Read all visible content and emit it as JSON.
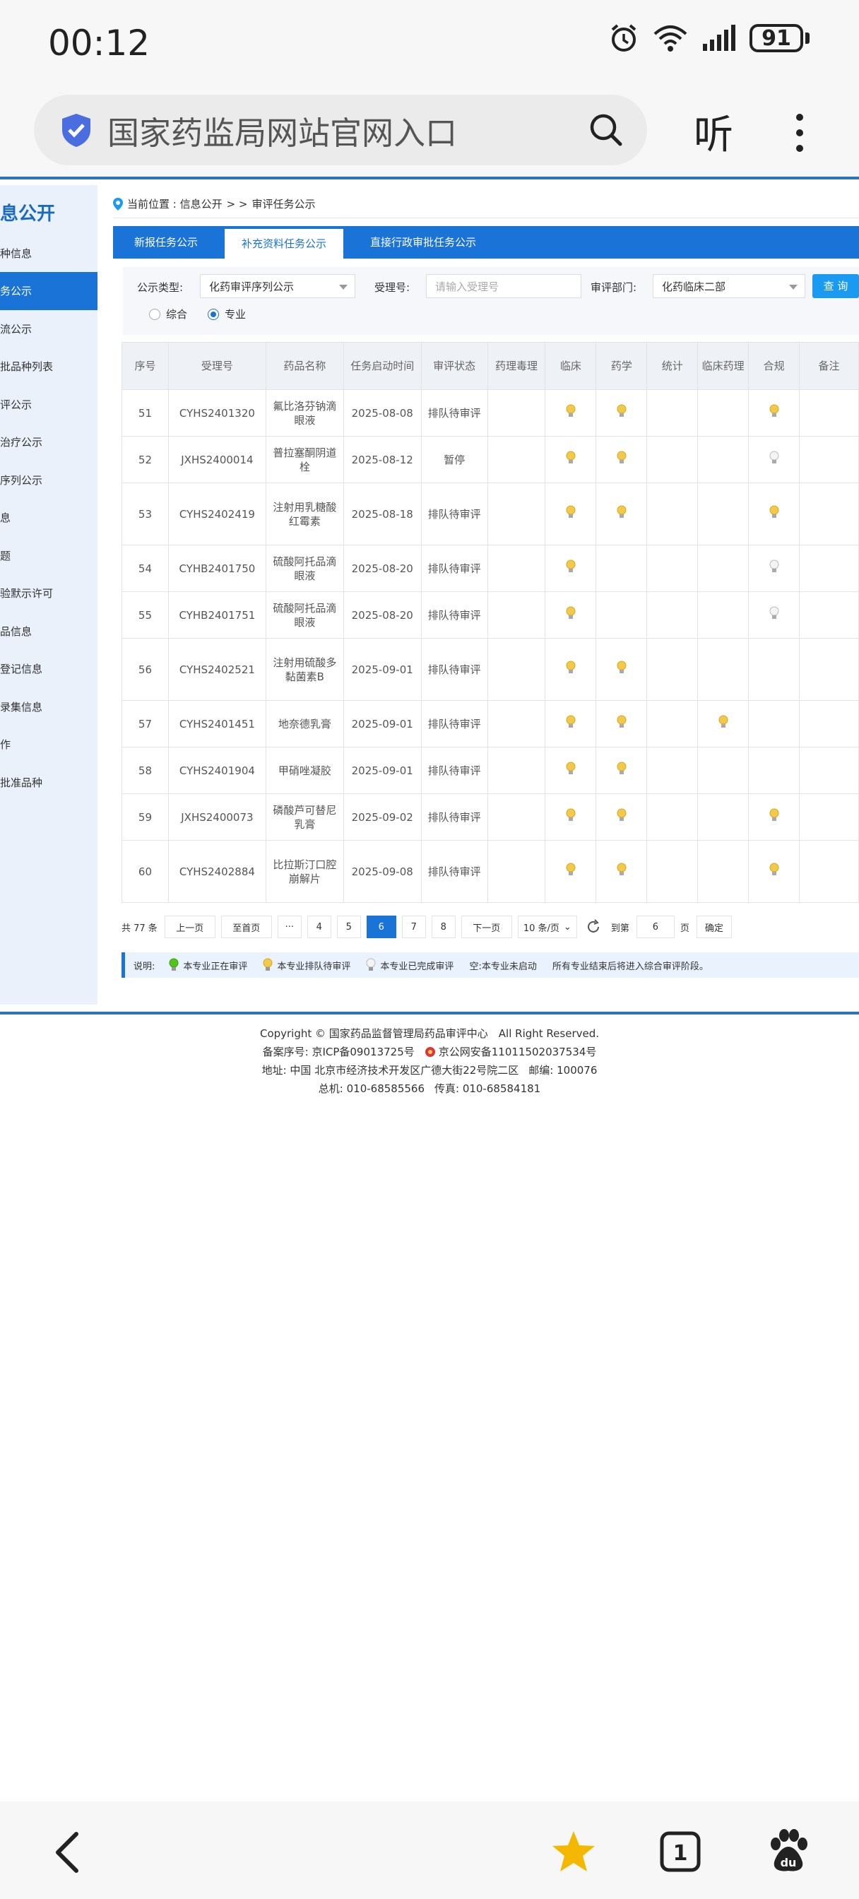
{
  "status_bar": {
    "time": "00:12",
    "battery": "91"
  },
  "browser": {
    "url_text": "国家药监局网站官网入口",
    "listen_label": "听"
  },
  "sidebar": {
    "title": "息公开",
    "active_item": "务公示",
    "items": [
      "种信息",
      "流公示",
      "批品种列表",
      "评公示",
      "治疗公示",
      "序列公示",
      "息",
      "题",
      "验默示许可",
      "品信息",
      "登记信息",
      "录集信息",
      "作",
      "批准品种"
    ]
  },
  "breadcrumb": {
    "prefix": "当前位置 : 信息公开",
    "sep": "> >",
    "current": "审评任务公示"
  },
  "tabs": [
    "新报任务公示",
    "补充资料任务公示",
    "直接行政审批任务公示"
  ],
  "filter": {
    "type_label": "公示类型:",
    "type_value": "化药审评序列公示",
    "accept_label": "受理号:",
    "accept_placeholder": "请输入受理号",
    "dept_label": "审评部门:",
    "dept_value": "化药临床二部",
    "query_button": "查 询",
    "radio_all": "综合",
    "radio_major": "专业"
  },
  "table": {
    "headers": [
      "序号",
      "受理号",
      "药品名称",
      "任务启动时间",
      "审评状态",
      "药理毒理",
      "临床",
      "药学",
      "统计",
      "临床药理",
      "合规",
      "备注"
    ],
    "rows": [
      {
        "no": "51",
        "code": "CYHS2401320",
        "name": "氟比洛芬钠滴眼液",
        "date": "2025-08-08",
        "status": "排队待审评",
        "lights": [
          "",
          "y",
          "y",
          "",
          "",
          "y",
          ""
        ]
      },
      {
        "no": "52",
        "code": "JXHS2400014",
        "name": "普拉塞酮阴道栓",
        "date": "2025-08-12",
        "status": "暂停",
        "lights": [
          "",
          "y",
          "y",
          "",
          "",
          "w",
          ""
        ]
      },
      {
        "no": "53",
        "code": "CYHS2402419",
        "name": "注射用乳糖酸红霉素",
        "date": "2025-08-18",
        "status": "排队待审评",
        "lights": [
          "",
          "y",
          "y",
          "",
          "",
          "y",
          ""
        ]
      },
      {
        "no": "54",
        "code": "CYHB2401750",
        "name": "硫酸阿托品滴眼液",
        "date": "2025-08-20",
        "status": "排队待审评",
        "lights": [
          "",
          "y",
          "",
          "",
          "",
          "w",
          ""
        ]
      },
      {
        "no": "55",
        "code": "CYHB2401751",
        "name": "硫酸阿托品滴眼液",
        "date": "2025-08-20",
        "status": "排队待审评",
        "lights": [
          "",
          "y",
          "",
          "",
          "",
          "w",
          ""
        ]
      },
      {
        "no": "56",
        "code": "CYHS2402521",
        "name": "注射用硫酸多黏菌素B",
        "date": "2025-09-01",
        "status": "排队待审评",
        "lights": [
          "",
          "y",
          "y",
          "",
          "",
          "",
          ""
        ]
      },
      {
        "no": "57",
        "code": "CYHS2401451",
        "name": "地奈德乳膏",
        "date": "2025-09-01",
        "status": "排队待审评",
        "lights": [
          "",
          "y",
          "y",
          "",
          "y",
          "",
          ""
        ]
      },
      {
        "no": "58",
        "code": "CYHS2401904",
        "name": "甲硝唑凝胶",
        "date": "2025-09-01",
        "status": "排队待审评",
        "lights": [
          "",
          "y",
          "y",
          "",
          "",
          "",
          ""
        ]
      },
      {
        "no": "59",
        "code": "JXHS2400073",
        "name": "磷酸芦可替尼乳膏",
        "date": "2025-09-02",
        "status": "排队待审评",
        "lights": [
          "",
          "y",
          "y",
          "",
          "",
          "y",
          ""
        ]
      },
      {
        "no": "60",
        "code": "CYHS2402884",
        "name": "比拉斯汀口腔崩解片",
        "date": "2025-09-08",
        "status": "排队待审评",
        "lights": [
          "",
          "y",
          "y",
          "",
          "",
          "y",
          ""
        ]
      }
    ]
  },
  "pagination": {
    "total": "共 77 条",
    "prev": "上一页",
    "first": "至首页",
    "ellipsis": "···",
    "pages": [
      "4",
      "5",
      "6",
      "7",
      "8"
    ],
    "current": "6",
    "next": "下一页",
    "page_size": "10 条/页",
    "goto_label": "到第",
    "goto_value": "6",
    "page_unit": "页",
    "confirm": "确定"
  },
  "legend": {
    "label": "说明:",
    "green": "本专业正在审评",
    "yellow": "本专业排队待审评",
    "white": "本专业已完成审评",
    "empty": "空:本专业未启动",
    "note": "所有专业结束后将进入综合审评阶段。"
  },
  "footer": {
    "copyright": "Copyright © 国家药品监督管理局药品审评中心　All Right Reserved.",
    "icp": "备案序号: 京ICP备09013725号",
    "police": "京公网安备11011502037534号",
    "address": "地址: 中国 北京市经济技术开发区广德大街22号院二区",
    "zip": "邮编: 100076",
    "phone": "总机: 010-68585566",
    "fax": "传真: 010-68584181"
  },
  "colors": {
    "primary": "#1a73d6",
    "bulb_yellow": "#f2c94c",
    "bulb_green": "#52c41a",
    "bulb_white": "#e8e8e8"
  }
}
